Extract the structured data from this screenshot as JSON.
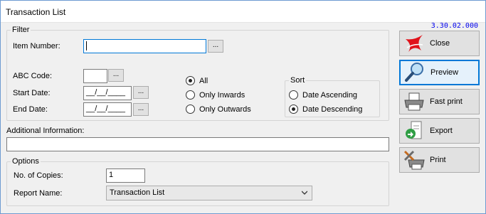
{
  "window": {
    "title": "Transaction List",
    "version": "3.30.02.000"
  },
  "filter": {
    "group_label": "Filter",
    "item_number": {
      "label": "Item Number:",
      "value": ""
    },
    "abc_code": {
      "label": "ABC Code:",
      "value": ""
    },
    "start_date": {
      "label": "Start Date:",
      "value": "__/__/____"
    },
    "end_date": {
      "label": "End Date:",
      "value": "__/__/____"
    },
    "browse_label": "...",
    "direction": {
      "options": [
        {
          "label": "All",
          "selected": true
        },
        {
          "label": "Only Inwards",
          "selected": false
        },
        {
          "label": "Only Outwards",
          "selected": false
        }
      ]
    },
    "sort": {
      "group_label": "Sort",
      "options": [
        {
          "label": "Date Ascending",
          "selected": false
        },
        {
          "label": "Date Descending",
          "selected": true
        }
      ]
    }
  },
  "additional": {
    "label": "Additional Information:",
    "value": ""
  },
  "options": {
    "group_label": "Options",
    "copies": {
      "label": "No. of Copies:",
      "value": "1"
    },
    "report_name": {
      "label": "Report Name:",
      "value": "Transaction List"
    }
  },
  "actions": {
    "close": "Close",
    "preview": "Preview",
    "fast_print": "Fast print",
    "export": "Export",
    "print": "Print"
  }
}
